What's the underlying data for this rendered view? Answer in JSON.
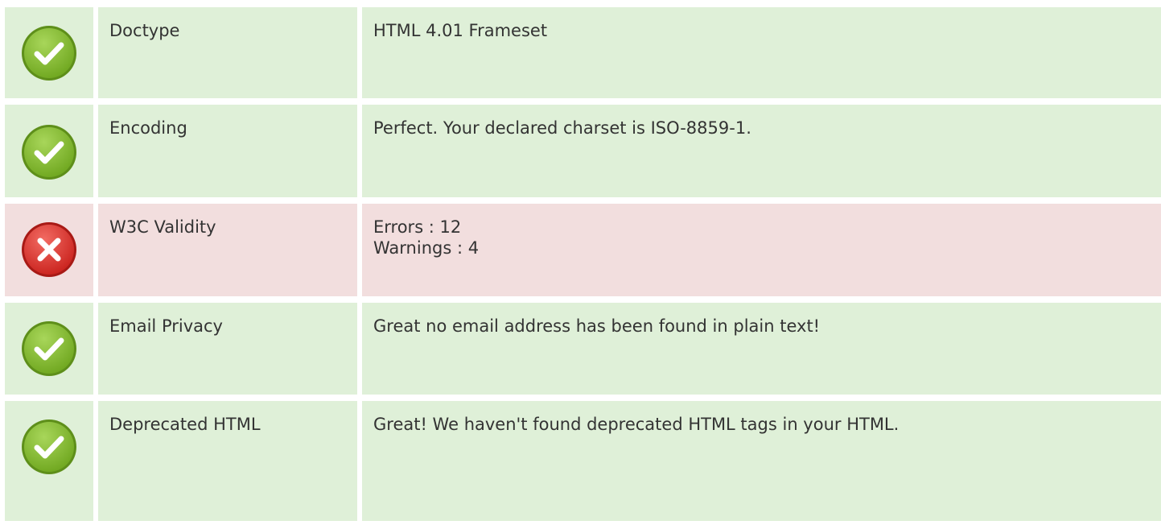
{
  "colors": {
    "ok_bg": "#dff0d8",
    "bad_bg": "#f2dede",
    "ok_icon": "#8cc63f",
    "bad_icon": "#e2403c"
  },
  "rows": [
    {
      "status": "check-icon",
      "label": "Doctype",
      "value_lines": [
        "HTML 4.01 Frameset"
      ]
    },
    {
      "status": "check-icon",
      "label": "Encoding",
      "value_lines": [
        "Perfect. Your declared charset is ISO-8859-1."
      ]
    },
    {
      "status": "cross-icon",
      "label": "W3C Validity",
      "value_lines": [
        "Errors : 12",
        "Warnings : 4"
      ]
    },
    {
      "status": "check-icon",
      "label": "Email Privacy",
      "value_lines": [
        "Great no email address has been found in plain text!"
      ]
    },
    {
      "status": "check-icon",
      "label": "Deprecated HTML",
      "value_lines": [
        "Great! We haven't found deprecated HTML tags in your HTML."
      ]
    }
  ]
}
